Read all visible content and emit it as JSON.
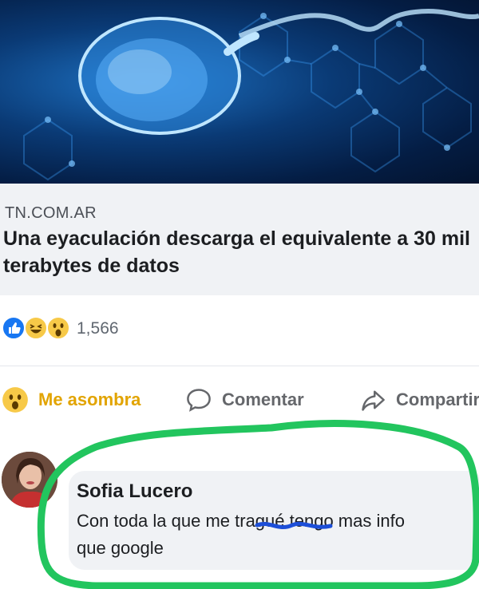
{
  "post": {
    "image_alt_icon": "sperm-cell-illustration",
    "link": {
      "source": "TN.COM.AR",
      "headline": "Una eyaculación descarga el equivalente a 30 mil terabytes de datos"
    },
    "reactions": {
      "icons": [
        "like-icon",
        "haha-icon",
        "wow-icon"
      ],
      "count": "1,566"
    },
    "actions": {
      "react_label": "Me asombra",
      "comment_label": "Comentar",
      "share_label": "Compartir"
    }
  },
  "comment": {
    "author": "Sofia Lucero",
    "text_line1": "Con toda la que me tragué tengo mas info",
    "text_line2": "que google"
  },
  "colors": {
    "accent_wow": "#e2a400",
    "highlight_circle": "#22c55e",
    "scribble": "#1d4fd8"
  }
}
